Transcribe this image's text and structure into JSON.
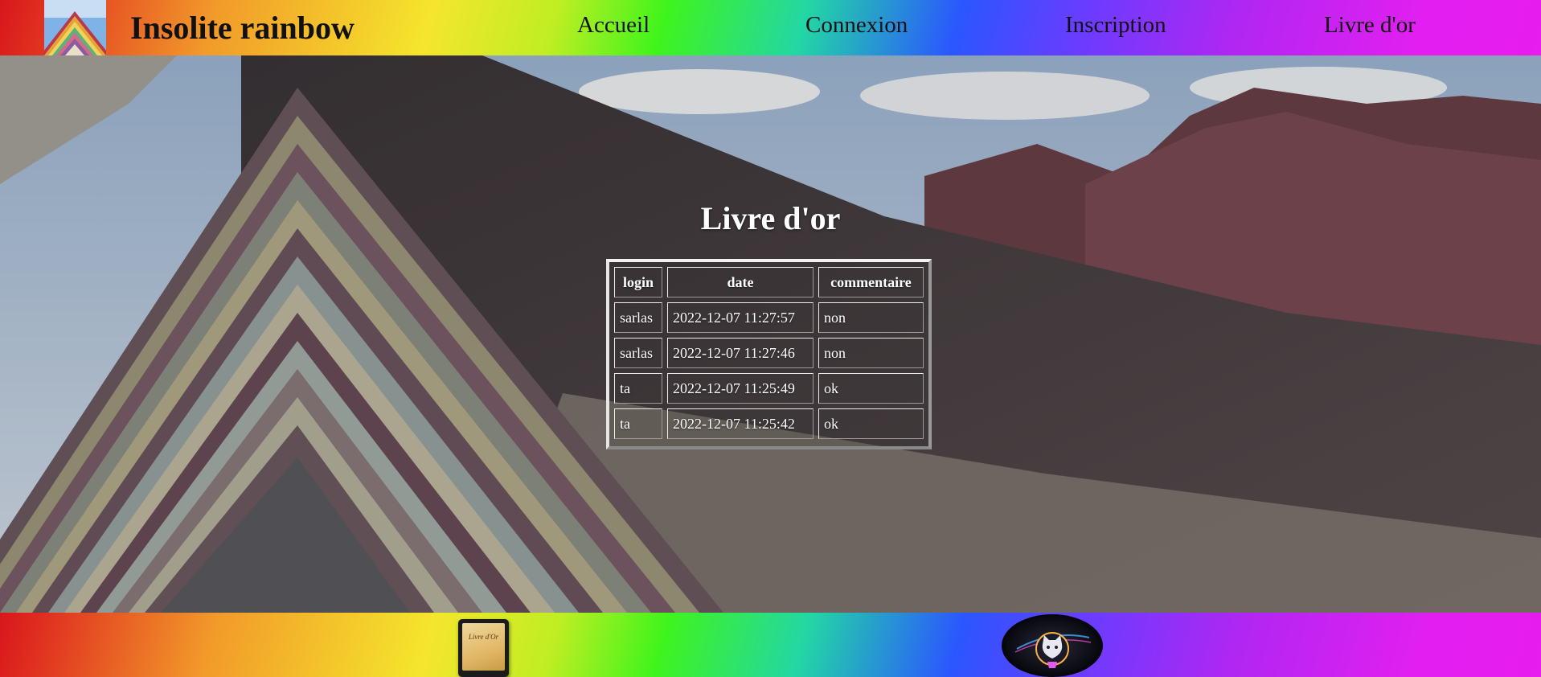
{
  "header": {
    "site_title": "Insolite rainbow",
    "nav": [
      {
        "label": "Accueil"
      },
      {
        "label": "Connexion"
      },
      {
        "label": "Inscription"
      },
      {
        "label": "Livre d'or"
      }
    ]
  },
  "main": {
    "title": "Livre d'or",
    "table": {
      "headers": [
        "login",
        "date",
        "commentaire"
      ],
      "rows": [
        [
          "sarlas",
          "2022-12-07 11:27:57",
          "non"
        ],
        [
          "sarlas",
          "2022-12-07 11:27:46",
          "non"
        ],
        [
          "ta",
          "2022-12-07 11:25:49",
          "ok"
        ],
        [
          "ta",
          "2022-12-07 11:25:42",
          "ok"
        ]
      ]
    }
  },
  "footer": {
    "book_label": "Livre d'Or",
    "icons": [
      "guestbook-book-icon",
      "github-cat-icon"
    ]
  },
  "colors": {
    "rainbow": [
      "#d8161b",
      "#f5e62c",
      "#3ff41c",
      "#2b56ff",
      "#e21ff0"
    ],
    "text_dark": "#111111",
    "text_light": "#ffffff"
  }
}
